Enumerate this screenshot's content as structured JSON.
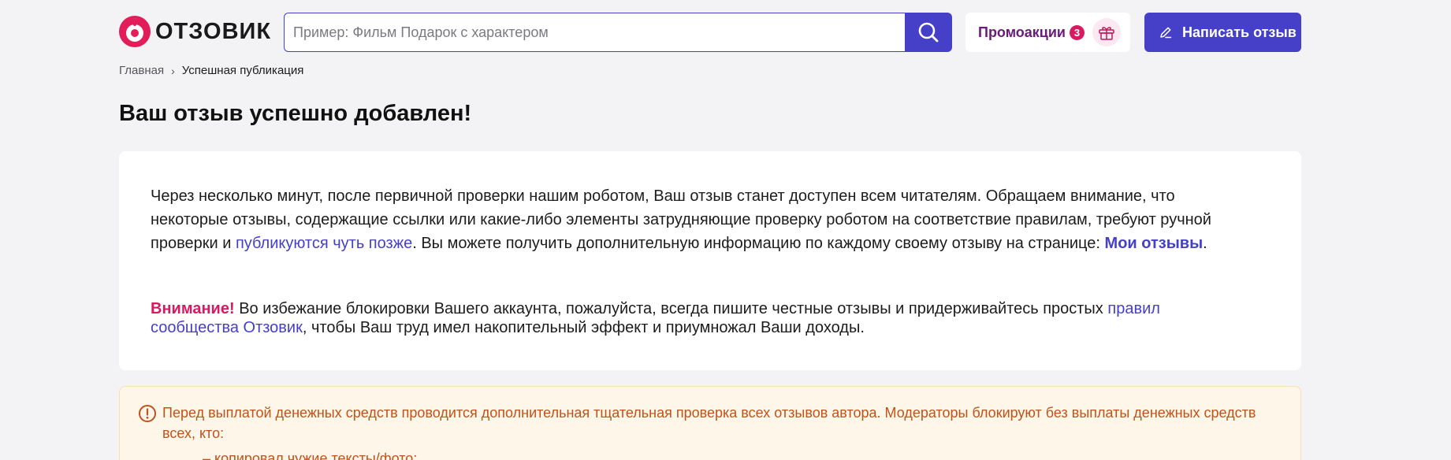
{
  "header": {
    "logo_text": "ОТЗОВИК",
    "search_placeholder": "Пример: Фильм Подарок с характером",
    "promo_label": "Промоакции",
    "promo_count": "3",
    "write_review_label": "Написать отзыв"
  },
  "breadcrumb": {
    "home": "Главная",
    "separator": "›",
    "current": "Успешная публикация"
  },
  "page_title": "Ваш отзыв успешно добавлен!",
  "card": {
    "p1_text1": "Через несколько минут, после первичной проверки нашим роботом, Ваш отзыв станет доступен всем читателям. Обращаем внимание, что некоторые отзывы, содержащие ссылки или какие-либо элементы затрудняющие проверку роботом на соответствие правилам, требуют ручной проверки и ",
    "p1_link1": "публикуются чуть позже",
    "p1_text2": ". Вы можете получить дополнительную информацию по каждому своему отзыву на странице: ",
    "p1_link2": "Мои отзывы",
    "p1_text3": ".",
    "p2_warning": "Внимание!",
    "p2_text1": " Во избежание блокировки Вашего аккаунта, пожалуйста, всегда пишите честные отзывы и придерживайтесь простых ",
    "p2_link": "правил сообщества Отзовик",
    "p2_text2": ", чтобы Ваш труд имел накопительный эффект и приумножал Ваши доходы."
  },
  "alert": {
    "text": "Перед выплатой денежных средств проводится дополнительная тщательная проверка всех отзывов автора. Модераторы блокируют без выплаты денежных средств всех, кто:",
    "list_item_1": "– копировал чужие тексты/фото;"
  },
  "colors": {
    "accent": "#4540c7",
    "brand_red": "#e11d5a",
    "warning_pink": "#d81b60",
    "alert_text": "#c0521a",
    "alert_bg": "#fef6e8"
  }
}
